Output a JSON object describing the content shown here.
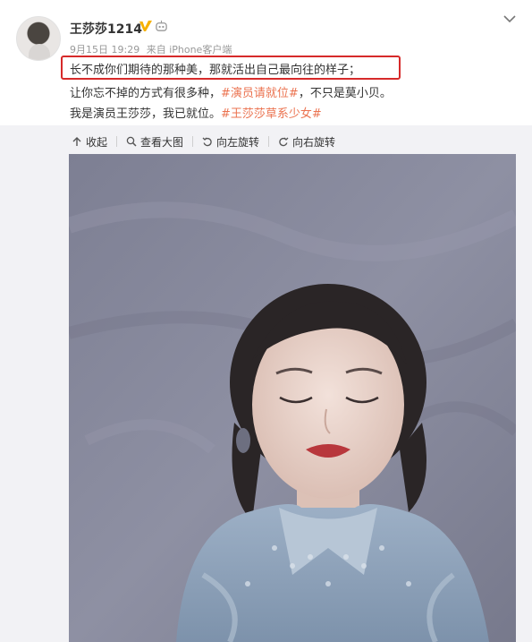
{
  "post": {
    "username": "王莎莎1214",
    "date": "9月15日 19:29",
    "source": "来自 iPhone客户端",
    "lines": [
      {
        "text": "长不成你们期待的那种美，那就活出自己最向往的样子；"
      },
      {
        "text_before": "让你忘不掉的方式有很多种，",
        "tag": "#演员请就位#",
        "text_after": "，不只是莫小贝。"
      },
      {
        "text_before": "我是演员王莎莎，我已就位。",
        "tag": "#王莎莎草系少女#",
        "text_after": ""
      }
    ]
  },
  "toolbar": {
    "collapse": "收起",
    "view_large": "查看大图",
    "rotate_left": "向左旋转",
    "rotate_right": "向右旋转"
  },
  "icons": [
    "chevron-down-icon",
    "verified-icon",
    "robot-icon",
    "collapse-icon",
    "zoom-icon",
    "rotate-left-icon",
    "rotate-right-icon"
  ],
  "colors": {
    "tag": "#eb7350",
    "highlight_border": "#d62a2a",
    "verified": "#f6b100",
    "panel_bg": "#f2f2f5"
  }
}
